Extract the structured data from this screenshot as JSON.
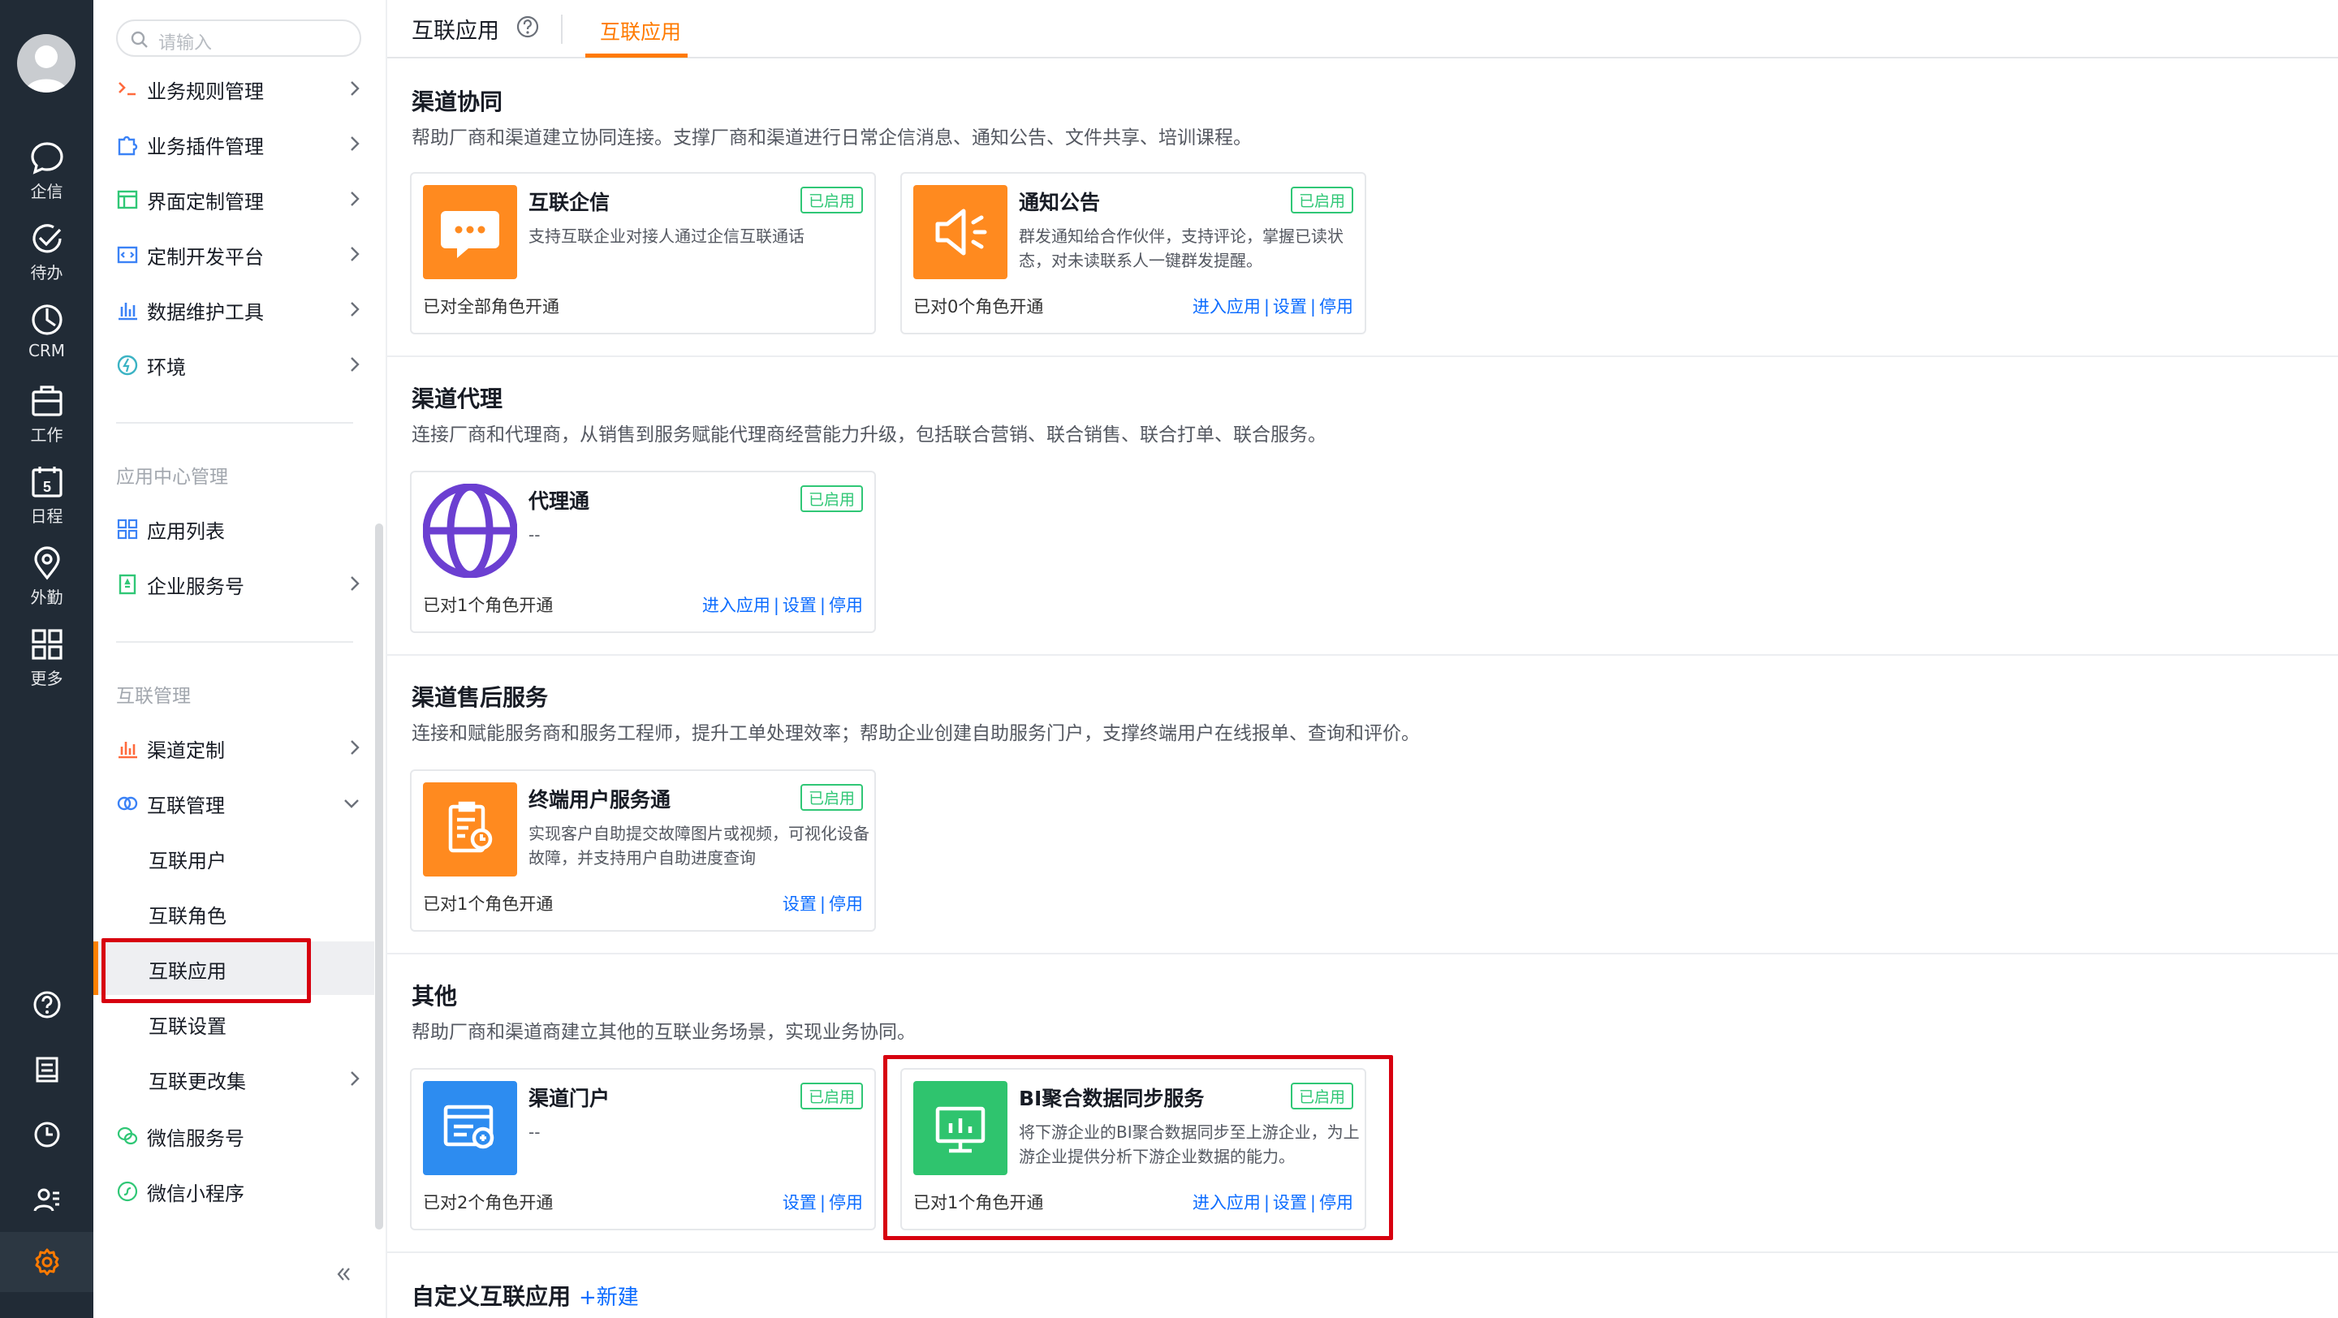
{
  "nav": {
    "items": [
      {
        "label": "企信",
        "icon": "chat-icon"
      },
      {
        "label": "待办",
        "icon": "check-circle-icon"
      },
      {
        "label": "CRM",
        "icon": "pie-chart-icon"
      },
      {
        "label": "工作",
        "icon": "briefcase-icon"
      },
      {
        "label": "日程",
        "icon": "calendar-icon",
        "day": "5"
      },
      {
        "label": "外勤",
        "icon": "location-icon"
      },
      {
        "label": "更多",
        "icon": "grid-icon"
      }
    ]
  },
  "sidebar": {
    "search_placeholder": "请输入",
    "items_top": [
      {
        "label": "业务规则管理"
      },
      {
        "label": "业务插件管理"
      },
      {
        "label": "界面定制管理"
      },
      {
        "label": "定制开发平台"
      },
      {
        "label": "数据维护工具"
      },
      {
        "label": "环境"
      }
    ],
    "section_app_center": "应用中心管理",
    "items_app_center": [
      {
        "label": "应用列表"
      },
      {
        "label": "企业服务号"
      }
    ],
    "section_interconnect": "互联管理",
    "items_interconnect": [
      {
        "label": "渠道定制"
      },
      {
        "label": "互联管理"
      }
    ],
    "sub_items": [
      {
        "label": "互联用户"
      },
      {
        "label": "互联角色"
      },
      {
        "label": "互联应用"
      },
      {
        "label": "互联设置"
      },
      {
        "label": "互联更改集"
      }
    ],
    "items_bottom": [
      {
        "label": "微信服务号"
      },
      {
        "label": "微信小程序"
      }
    ]
  },
  "header": {
    "title": "互联应用",
    "active_tab": "互联应用"
  },
  "sections": [
    {
      "title": "渠道协同",
      "desc": "帮助厂商和渠道建立协同连接。支撑厂商和渠道进行日常企信消息、通知公告、文件共享、培训课程。",
      "cards": [
        {
          "name": "互联企信",
          "badge": "已启用",
          "desc": "支持互联企业对接人通过企信互联通话",
          "footer": "已对全部角色开通",
          "actions": []
        },
        {
          "name": "通知公告",
          "badge": "已启用",
          "desc": "群发通知给合作伙伴，支持评论，掌握已读状态，对未读联系人一键群发提醒。",
          "footer": "已对0个角色开通",
          "actions": [
            "进入应用",
            "设置",
            "停用"
          ]
        }
      ]
    },
    {
      "title": "渠道代理",
      "desc": "连接厂商和代理商，从销售到服务赋能代理商经营能力升级，包括联合营销、联合销售、联合打单、联合服务。",
      "cards": [
        {
          "name": "代理通",
          "badge": "已启用",
          "desc": "--",
          "footer": "已对1个角色开通",
          "actions": [
            "进入应用",
            "设置",
            "停用"
          ]
        }
      ]
    },
    {
      "title": "渠道售后服务",
      "desc": "连接和赋能服务商和服务工程师，提升工单处理效率；帮助企业创建自助服务门户，支撑终端用户在线报单、查询和评价。",
      "cards": [
        {
          "name": "终端用户服务通",
          "badge": "已启用",
          "desc": "实现客户自助提交故障图片或视频，可视化设备故障，并支持用户自助进度查询",
          "footer": "已对1个角色开通",
          "actions": [
            "设置",
            "停用"
          ]
        }
      ]
    },
    {
      "title": "其他",
      "desc": "帮助厂商和渠道商建立其他的互联业务场景，实现业务协同。",
      "cards": [
        {
          "name": "渠道门户",
          "badge": "已启用",
          "desc": "--",
          "footer": "已对2个角色开通",
          "actions": [
            "设置",
            "停用"
          ]
        },
        {
          "name": "BI聚合数据同步服务",
          "badge": "已启用",
          "desc": "将下游企业的BI聚合数据同步至上游企业，为上游企业提供分析下游企业数据的能力。",
          "footer": "已对1个角色开通",
          "actions": [
            "进入应用",
            "设置",
            "停用"
          ]
        }
      ]
    }
  ],
  "custom": {
    "title": "自定义互联应用",
    "new_label": "+新建"
  },
  "colors": {
    "accent": "#ff7a00",
    "link": "#0c6cff",
    "badge_green": "#30c776",
    "highlight_red": "#d7000f",
    "nav_bg": "#212b36"
  }
}
